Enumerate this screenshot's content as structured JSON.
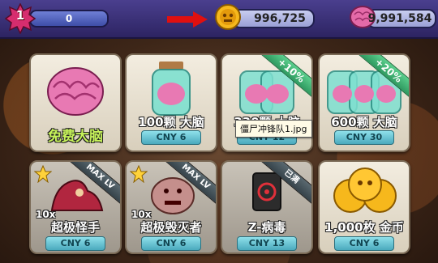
{
  "header": {
    "level": "1",
    "xp_value": "0",
    "xp_progress": 0.0,
    "coins": "996,725",
    "brains": "9,991,584"
  },
  "shop": {
    "cards": [
      {
        "title": "免费大脑"
      },
      {
        "title": "100颗 大脑",
        "price": "CNY 6"
      },
      {
        "title": "330颗 大脑",
        "price": "CNY 12",
        "ribbon": "+10%"
      },
      {
        "title": "600颗 大脑",
        "price": "CNY 30",
        "ribbon": "+20%"
      },
      {
        "qty": "10x",
        "title": "超极怪手",
        "price": "CNY 6",
        "ribbon": "MAX LV"
      },
      {
        "qty": "10x",
        "title": "超极毁灭者",
        "price": "CNY 6",
        "ribbon": "MAX LV"
      },
      {
        "title": "Z-病毒",
        "price": "CNY 13",
        "ribbon": "已满"
      },
      {
        "title": "1,000枚 金币",
        "price": "CNY 6"
      }
    ]
  },
  "tooltip": "僵尸冲锋队1.jpg",
  "colors": {
    "accent_green": "#c6f25a",
    "price_teal": "#4aa9bd",
    "topbar": "#3b327a",
    "arrow_red": "#e01010"
  }
}
